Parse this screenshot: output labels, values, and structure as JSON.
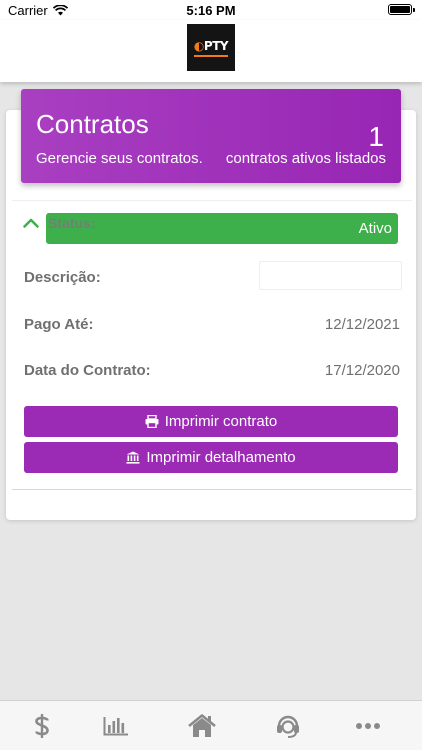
{
  "status_bar": {
    "carrier": "Carrier",
    "time": "5:16 PM"
  },
  "header": {
    "logo_text": "PTY",
    "logo_icon": "opty-logo"
  },
  "banner": {
    "title": "Contratos",
    "subtitle": "Gerencie seus contratos.",
    "count": "1",
    "count_label": "contratos ativos listados",
    "color": "#9b2ab5"
  },
  "contract": {
    "status_label": "Status:",
    "status_value": "Ativo",
    "status_color": "#3daf4b",
    "description_label": "Descrição:",
    "description_value": "",
    "paid_until_label": "Pago Até:",
    "paid_until_value": "12/12/2021",
    "contract_date_label": "Data do Contrato:",
    "contract_date_value": "17/12/2020",
    "print_contract_label": "Imprimir contrato",
    "print_details_label": "Imprimir detalhamento"
  },
  "tabbar": {
    "items": [
      {
        "icon": "dollar-icon"
      },
      {
        "icon": "bar-chart-icon"
      },
      {
        "icon": "home-icon"
      },
      {
        "icon": "headset-icon"
      },
      {
        "icon": "more-icon"
      }
    ]
  }
}
